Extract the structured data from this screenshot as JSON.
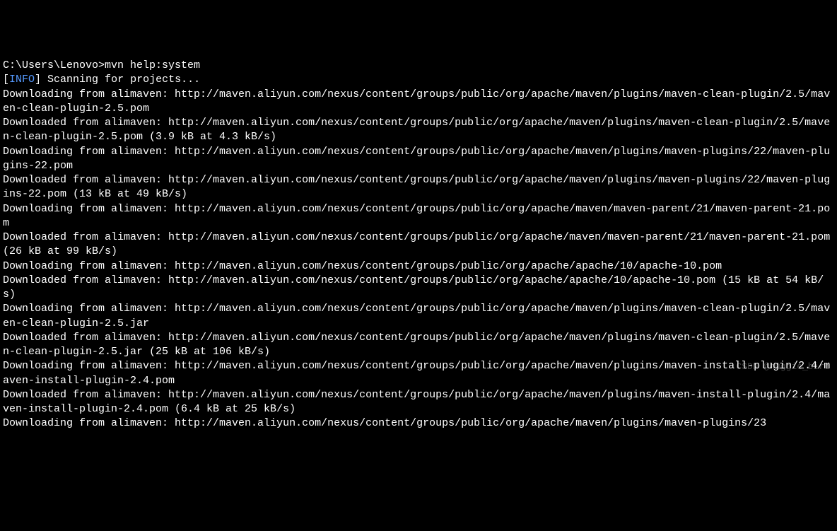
{
  "terminal": {
    "prompt": "C:\\Users\\Lenovo>",
    "command": "mvn help:system",
    "info_label": "INFO",
    "scanning_text": " Scanning for projects...",
    "lines": [
      "Downloading from alimaven: http://maven.aliyun.com/nexus/content/groups/public/org/apache/maven/plugins/maven-clean-plugin/2.5/maven-clean-plugin-2.5.pom",
      "Downloaded from alimaven: http://maven.aliyun.com/nexus/content/groups/public/org/apache/maven/plugins/maven-clean-plugin/2.5/maven-clean-plugin-2.5.pom (3.9 kB at 4.3 kB/s)",
      "Downloading from alimaven: http://maven.aliyun.com/nexus/content/groups/public/org/apache/maven/plugins/maven-plugins/22/maven-plugins-22.pom",
      "Downloaded from alimaven: http://maven.aliyun.com/nexus/content/groups/public/org/apache/maven/plugins/maven-plugins/22/maven-plugins-22.pom (13 kB at 49 kB/s)",
      "Downloading from alimaven: http://maven.aliyun.com/nexus/content/groups/public/org/apache/maven/maven-parent/21/maven-parent-21.pom",
      "Downloaded from alimaven: http://maven.aliyun.com/nexus/content/groups/public/org/apache/maven/maven-parent/21/maven-parent-21.pom (26 kB at 99 kB/s)",
      "Downloading from alimaven: http://maven.aliyun.com/nexus/content/groups/public/org/apache/apache/10/apache-10.pom",
      "Downloaded from alimaven: http://maven.aliyun.com/nexus/content/groups/public/org/apache/apache/10/apache-10.pom (15 kB at 54 kB/s)",
      "Downloading from alimaven: http://maven.aliyun.com/nexus/content/groups/public/org/apache/maven/plugins/maven-clean-plugin/2.5/maven-clean-plugin-2.5.jar",
      "Downloaded from alimaven: http://maven.aliyun.com/nexus/content/groups/public/org/apache/maven/plugins/maven-clean-plugin/2.5/maven-clean-plugin-2.5.jar (25 kB at 106 kB/s)",
      "Downloading from alimaven: http://maven.aliyun.com/nexus/content/groups/public/org/apache/maven/plugins/maven-install-plugin/2.4/maven-install-plugin-2.4.pom",
      "Downloaded from alimaven: http://maven.aliyun.com/nexus/content/groups/public/org/apache/maven/plugins/maven-install-plugin/2.4/maven-install-plugin-2.4.pom (6.4 kB at 25 kB/s)",
      "Downloading from alimaven: http://maven.aliyun.com/nexus/content/groups/public/org/apache/maven/plugins/maven-plugins/23"
    ],
    "watermark": "CSDN @huggie_bird"
  }
}
